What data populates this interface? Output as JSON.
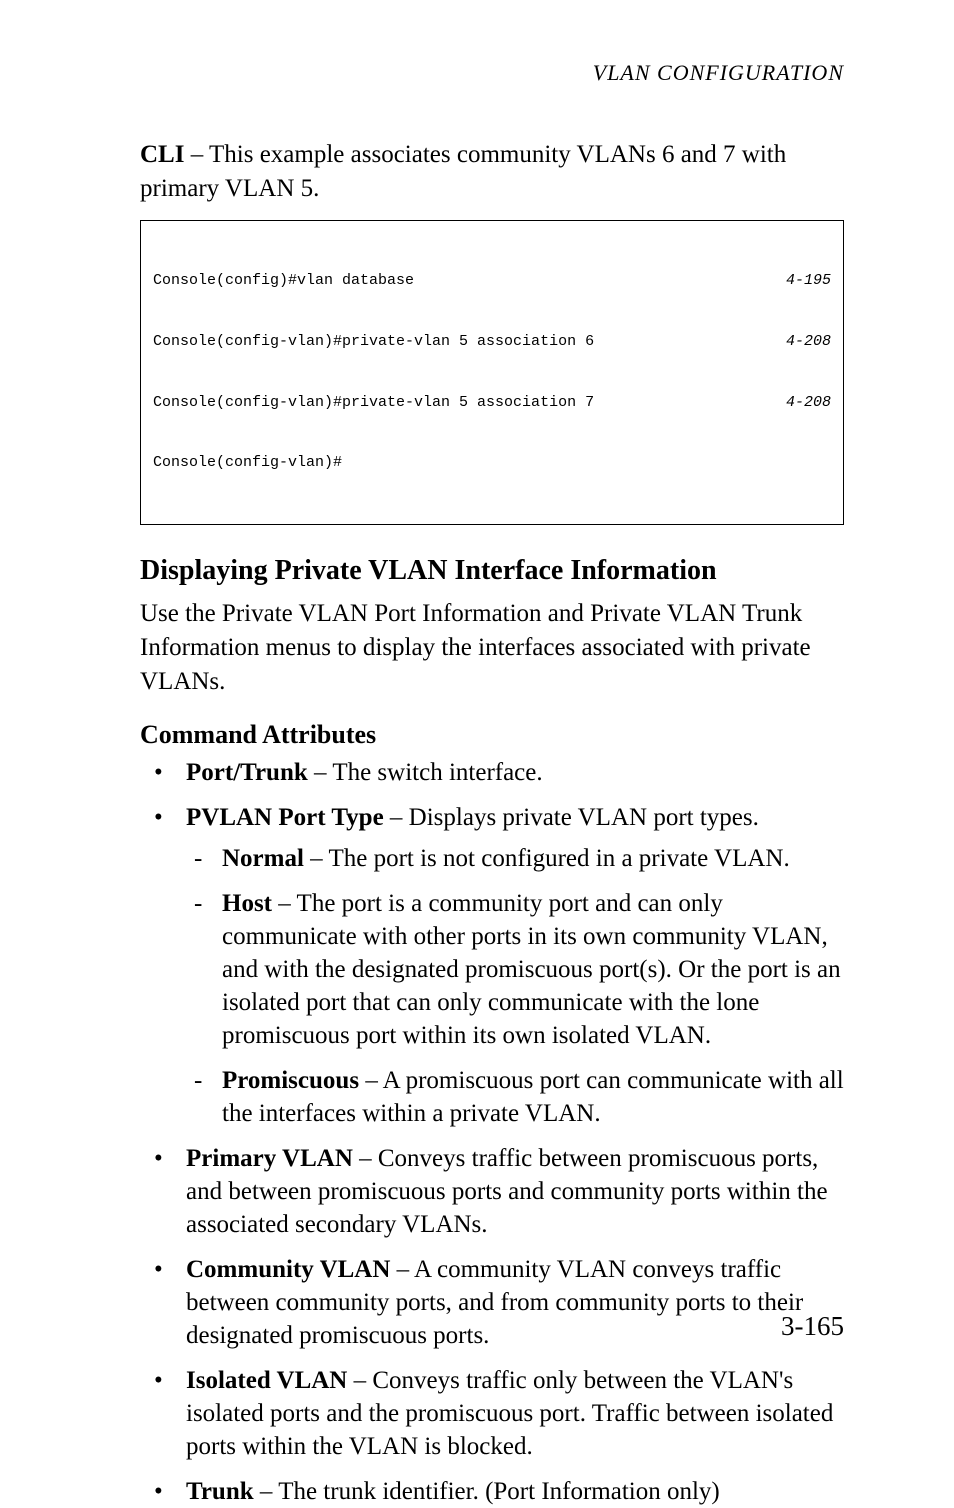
{
  "running_head": "VLAN CONFIGURATION",
  "intro_cli_label": "CLI",
  "intro_text": " – This example associates community VLANs 6 and 7 with primary VLAN 5.",
  "code": {
    "lines": [
      {
        "cmd": "Console(config)#vlan database",
        "ref": "4-195"
      },
      {
        "cmd": "Console(config-vlan)#private-vlan 5 association 6",
        "ref": "4-208"
      },
      {
        "cmd": "Console(config-vlan)#private-vlan 5 association 7",
        "ref": "4-208"
      },
      {
        "cmd": "Console(config-vlan)#",
        "ref": ""
      }
    ]
  },
  "section_heading": "Displaying Private VLAN Interface Information",
  "section_para": "Use the Private VLAN Port Information and Private VLAN Trunk Information menus to display the interfaces associated with private VLANs.",
  "attrs_heading": "Command Attributes",
  "bullets": [
    {
      "term": "Port/Trunk",
      "desc": " – The switch interface."
    },
    {
      "term": "PVLAN Port Type",
      "desc": " – Displays private VLAN port types.",
      "sub": [
        {
          "term": "Normal",
          "desc": " – The port is not configured in a private VLAN."
        },
        {
          "term": "Host",
          "desc": " – The port is a community port and can only communicate with other ports in its own community VLAN, and with the designated promiscuous port(s). Or the port is an isolated port that can only communicate with the lone promiscuous port within its own isolated VLAN."
        },
        {
          "term": "Promiscuous",
          "desc": " – A promiscuous port can communicate with all the interfaces within a private VLAN."
        }
      ]
    },
    {
      "term": "Primary VLAN",
      "desc": " – Conveys traffic between promiscuous ports, and between promiscuous ports and community ports within the associated secondary VLANs."
    },
    {
      "term": "Community VLAN",
      "desc": " – A community VLAN conveys traffic between community ports, and from community ports to their designated promiscuous ports."
    },
    {
      "term": "Isolated VLAN",
      "desc": " –  Conveys traffic only between the VLAN's isolated ports and the promiscuous port. Traffic between isolated ports within the VLAN is blocked."
    },
    {
      "term": "Trunk",
      "desc": " – The trunk identifier. (Port Information only)"
    }
  ],
  "page_number": "3-165"
}
